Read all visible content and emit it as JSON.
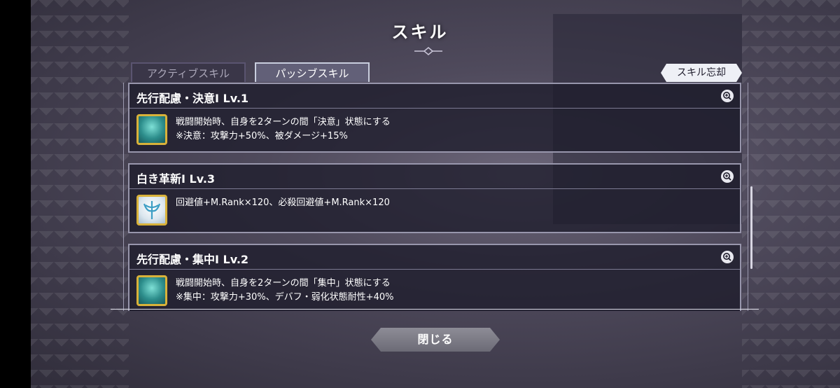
{
  "header": {
    "title": "スキル"
  },
  "tabs": [
    {
      "label": "アクティブスキル",
      "active": false
    },
    {
      "label": "パッシブスキル",
      "active": true
    }
  ],
  "forget_button": {
    "label": "スキル忘却"
  },
  "skills": [
    {
      "name": "先行配慮・決意Ⅰ Lv.1",
      "icon": "teal-hood-icon",
      "lines": [
        "戦闘開始時、自身を2ターンの間「決意」状態にする",
        "※決意：攻撃力+50%、被ダメージ+15%"
      ]
    },
    {
      "name": "白き革新Ⅰ Lv.3",
      "icon": "white-wings-icon",
      "lines": [
        "回避値+M.Rank×120、必殺回避値+M.Rank×120",
        ""
      ]
    },
    {
      "name": "先行配慮・集中Ⅰ Lv.2",
      "icon": "teal-hood-icon",
      "lines": [
        "戦闘開始時、自身を2ターンの間「集中」状態にする",
        "※集中：攻撃力+30%、デバフ・弱化状態耐性+40%"
      ]
    }
  ],
  "close_button": {
    "label": "閉じる"
  },
  "colors": {
    "accent_gold": "#d9b23a",
    "panel_border": "#9896ac",
    "teal": "#2d8e8c"
  }
}
